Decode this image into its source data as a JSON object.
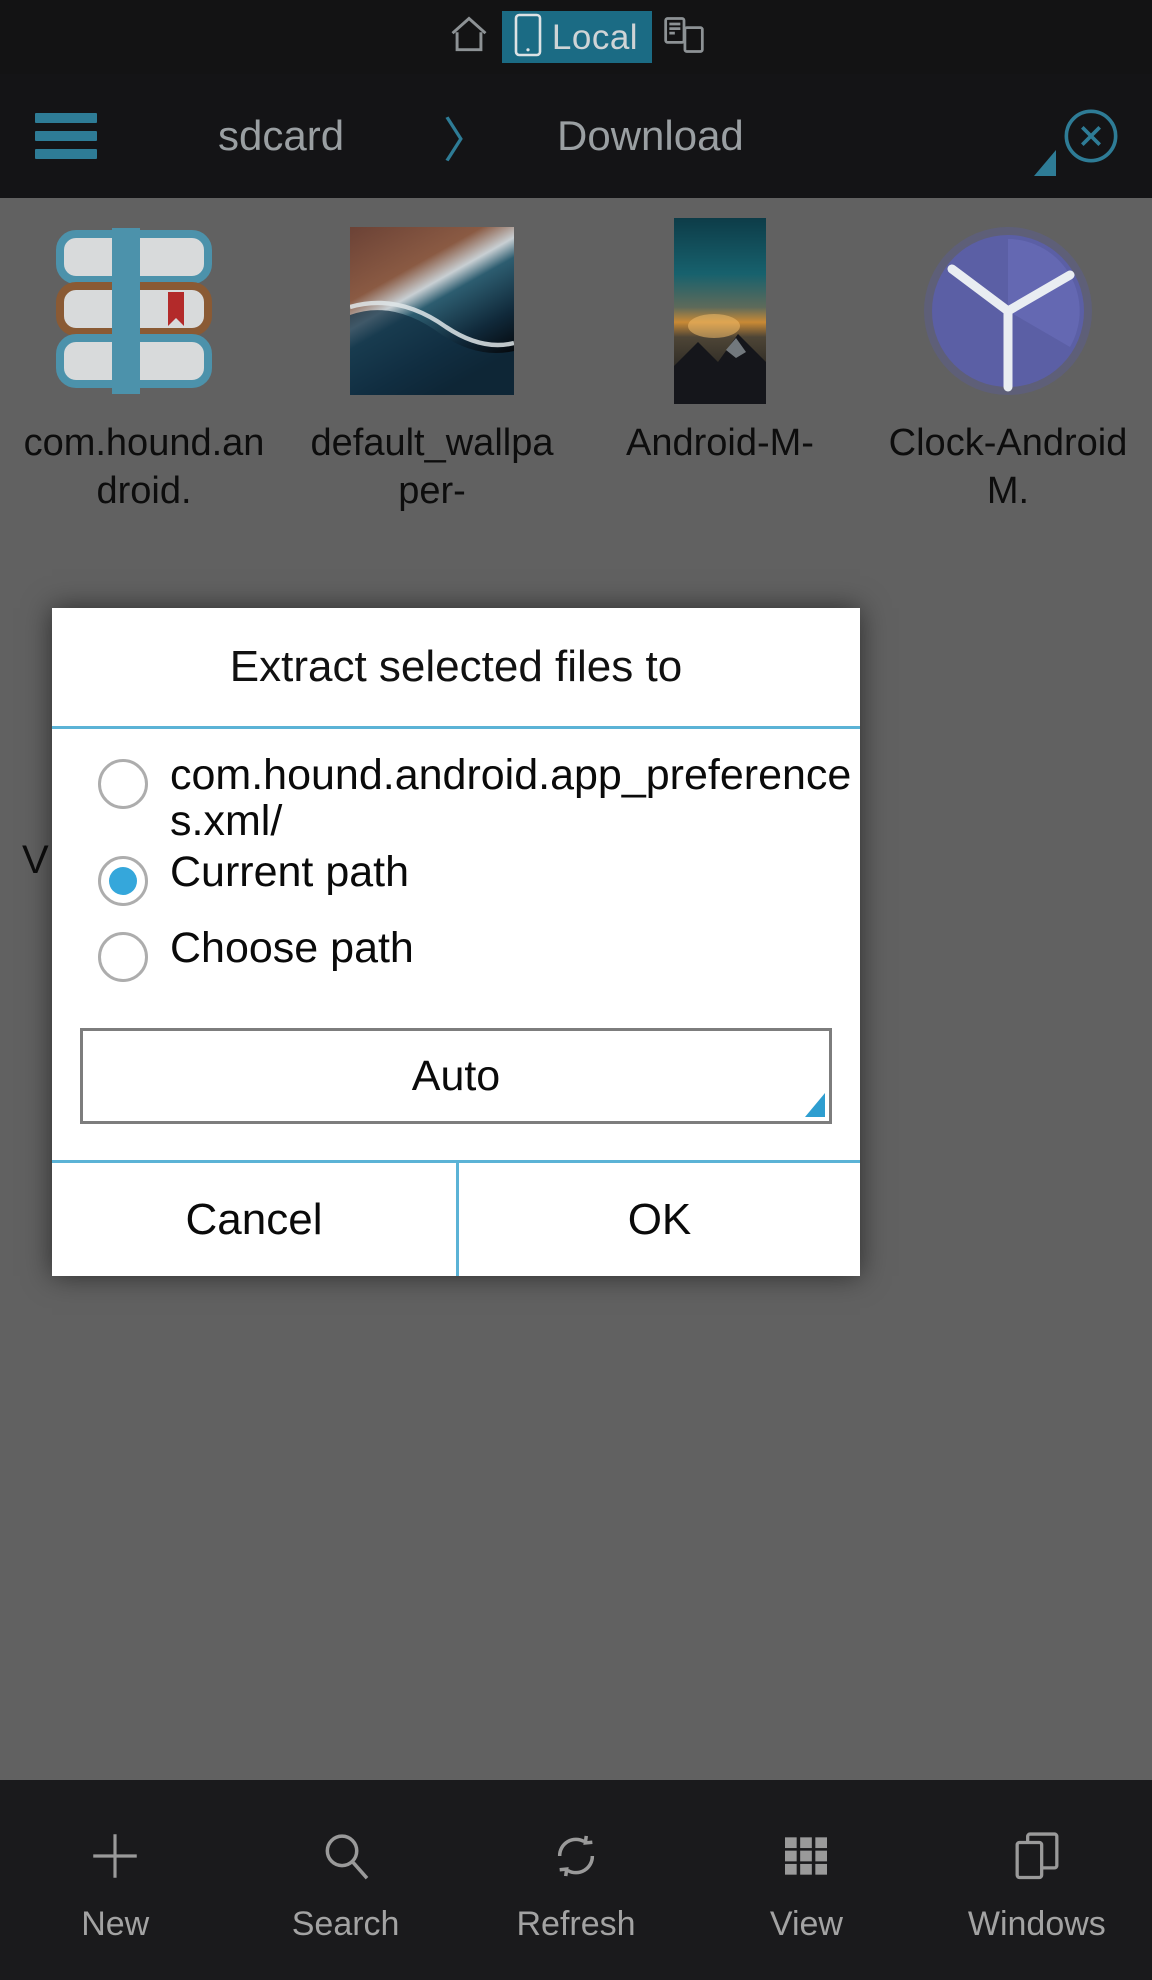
{
  "device_tabs": [
    {
      "id": "home",
      "icon": "home-icon",
      "label": "",
      "active": false
    },
    {
      "id": "local",
      "icon": "phone-icon",
      "label": "Local",
      "active": true
    },
    {
      "id": "network",
      "icon": "devices-icon",
      "label": "",
      "active": false
    }
  ],
  "navbar": {
    "menu_icon": "hamburger-icon",
    "breadcrumb": {
      "parent": "sdcard",
      "separator": "〉",
      "current": "Download"
    },
    "close_icon": "close-circle-icon",
    "resize_handle": "resize-corner-icon"
  },
  "files": [
    {
      "name": "com.hound.android.",
      "thumb": "books-icon"
    },
    {
      "name": "default_wallpaper-",
      "thumb": "coast-photo"
    },
    {
      "name": "Android-M-",
      "thumb": "sunset-photo"
    },
    {
      "name": "Clock-AndroidM.",
      "thumb": "clock-icon"
    }
  ],
  "background_text": "V",
  "dialog": {
    "title": "Extract selected files to",
    "options": [
      {
        "label": "com.hound.android.app_preferences.xml/",
        "selected": false
      },
      {
        "label": "Current path",
        "selected": true
      },
      {
        "label": "Choose path",
        "selected": false
      }
    ],
    "encoding_select": {
      "value": "Auto",
      "arrow": "dropdown-corner-icon"
    },
    "cancel_label": "Cancel",
    "ok_label": "OK"
  },
  "toolbar": [
    {
      "label": "New",
      "icon": "plus-icon"
    },
    {
      "label": "Search",
      "icon": "search-icon"
    },
    {
      "label": "Refresh",
      "icon": "refresh-icon"
    },
    {
      "label": "View",
      "icon": "grid-icon"
    },
    {
      "label": "Windows",
      "icon": "windows-icon"
    }
  ],
  "colors": {
    "accent": "#2e7c96",
    "dialog_rule": "#5bb3d6",
    "radio_on": "#35a7db",
    "tab_active_bg": "#1b6b84",
    "content_bg": "#616161"
  }
}
